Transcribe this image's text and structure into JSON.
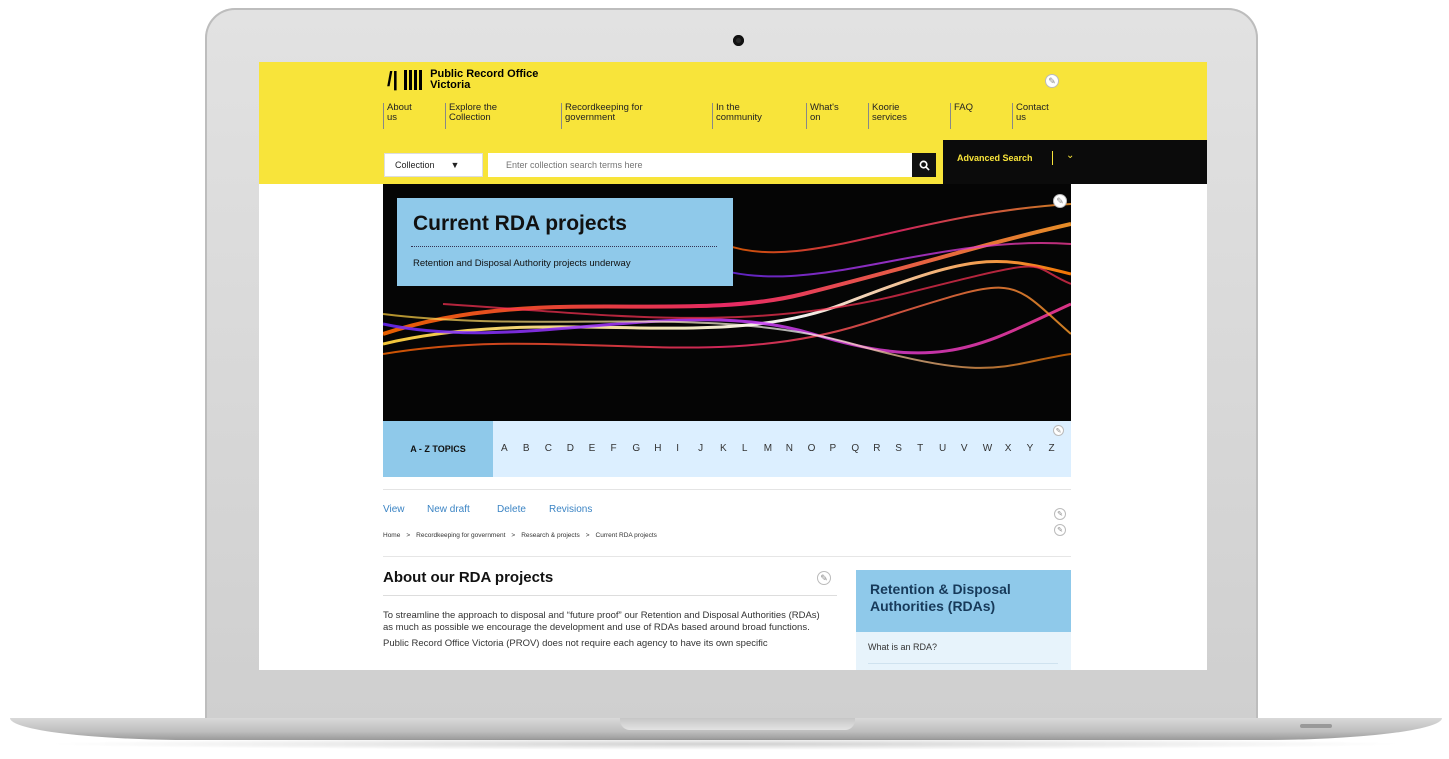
{
  "site": {
    "logo_text": "Public Record Office Victoria"
  },
  "nav": {
    "items": [
      {
        "label": "About us"
      },
      {
        "label": "Explore the Collection"
      },
      {
        "label": "Recordkeeping for government"
      },
      {
        "label": "In the community"
      },
      {
        "label": "What's on"
      },
      {
        "label": "Koorie services"
      },
      {
        "label": "FAQ"
      },
      {
        "label": "Contact us"
      }
    ]
  },
  "search": {
    "scope_label": "Collection",
    "placeholder": "Enter collection search terms here",
    "advanced_label": "Advanced Search"
  },
  "hero": {
    "title": "Current RDA projects",
    "subtitle": "Retention and Disposal Authority projects underway"
  },
  "az": {
    "label": "A - Z TOPICS",
    "letters": [
      "A",
      "B",
      "C",
      "D",
      "E",
      "F",
      "G",
      "H",
      "I",
      "J",
      "K",
      "L",
      "M",
      "N",
      "O",
      "P",
      "Q",
      "R",
      "S",
      "T",
      "U",
      "V",
      "W",
      "X",
      "Y",
      "Z"
    ]
  },
  "tabs": {
    "view": "View",
    "new_draft": "New draft",
    "delete": "Delete",
    "revisions": "Revisions"
  },
  "breadcrumb": {
    "items": [
      "Home",
      "Recordkeeping for government",
      "Research & projects",
      "Current RDA projects"
    ],
    "separator": ">"
  },
  "main": {
    "title": "About our RDA projects",
    "paragraphs": [
      "To streamline the approach to disposal and “future proof” our Retention and Disposal Authorities (RDAs) as much as possible we encourage the development and use of RDAs based around broad functions.",
      "Public Record Office Victoria (PROV) does not require each agency to have its own specific"
    ]
  },
  "sidebar": {
    "title": "Retention & Disposal Authorities (RDAs)",
    "items": [
      "What is an RDA?"
    ]
  },
  "icons": {
    "edit": "pencil-icon",
    "search": "magnifier-icon",
    "chevron": "chevron-down-icon"
  },
  "colors": {
    "brand_yellow": "#f8e43a",
    "accent_blue": "#8fc9ea",
    "link_blue": "#3b84c4"
  }
}
